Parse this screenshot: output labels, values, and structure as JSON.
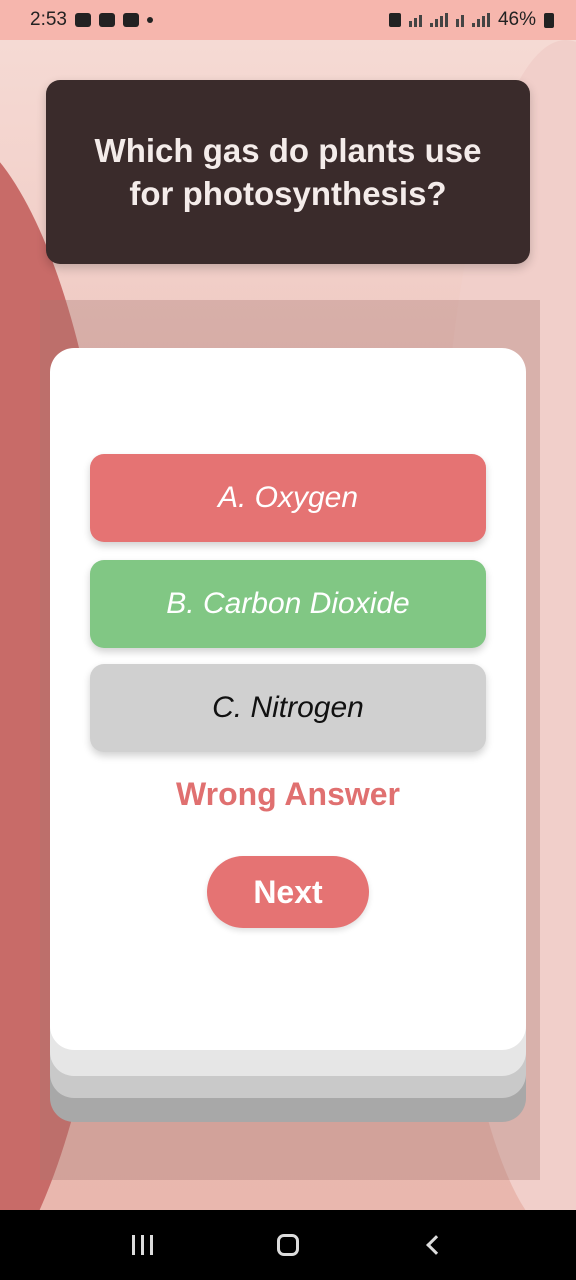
{
  "status_bar": {
    "time": "2:53",
    "battery": "46%",
    "left_icons": [
      "image-icon",
      "chat-icon",
      "folder-icon",
      "dot-icon"
    ],
    "right_icons": [
      "vpn-icon",
      "wifi-icon",
      "signal-icon",
      "wifi-calling-icon",
      "signal-icon-2",
      "battery-icon"
    ]
  },
  "quiz": {
    "question": "Which gas do plants use for photosynthesis?",
    "options": [
      {
        "label": "A. Oxygen",
        "state": "wrong",
        "color": "#e57373"
      },
      {
        "label": "B. Carbon Dioxide",
        "state": "correct",
        "color": "#81c784"
      },
      {
        "label": "C. Nitrogen",
        "state": "neutral",
        "color": "#d0d0d0"
      }
    ],
    "feedback": "Wrong Answer",
    "next_label": "Next"
  },
  "colors": {
    "question_bg": "#3a2b2b",
    "accent_wrong": "#e57373",
    "accent_correct": "#81c784"
  },
  "nav_bar": {
    "buttons": [
      "recent-apps-icon",
      "home-icon",
      "back-icon"
    ]
  }
}
